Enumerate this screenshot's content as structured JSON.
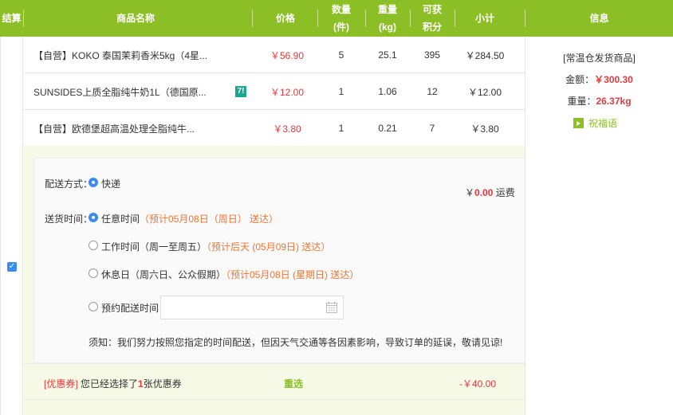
{
  "header": {
    "settle": "结算",
    "product_name": "商品名称",
    "price": "价格",
    "quantity_l1": "数量",
    "quantity_l2": "(件)",
    "weight_l1": "重量",
    "weight_l2": "(kg)",
    "points_l1": "可获",
    "points_l2": "积分",
    "subtotal": "小计",
    "info": "信息"
  },
  "items": [
    {
      "name": "【自营】KOKO 泰国茉莉香米5kg（4星...",
      "price": "￥56.90",
      "qty": "5",
      "weight": "25.1",
      "points": "395",
      "subtotal": "￥284.50"
    },
    {
      "name": "SUNSIDES上质全脂纯牛奶1L（德国原...",
      "price": "￥12.00",
      "qty": "1",
      "weight": "1.06",
      "points": "12",
      "subtotal": "￥12.00",
      "badge": "7!"
    },
    {
      "name": "【自营】欧德堡超高温处理全脂纯牛...",
      "price": "￥3.80",
      "qty": "1",
      "weight": "0.21",
      "points": "7",
      "subtotal": "￥3.80"
    }
  ],
  "info": {
    "warehouse": "[常温仓发货商品]",
    "amount_label": "金额：",
    "amount_value": "￥300.30",
    "weight_label": "重量：",
    "weight_value": "26.37kg",
    "blessing": "祝福语"
  },
  "shipping": {
    "method_label": "配送方式：",
    "method_option": "快递",
    "fee_prefix": "￥",
    "fee_value": "0.00",
    "fee_suffix": " 运费",
    "time_label": "送货时间：",
    "options": [
      {
        "label": "任意时间",
        "note": "（预计05月08日（周日） 送达）",
        "selected": true
      },
      {
        "label": "工作时间（周一至周五）",
        "note": "（预计后天 (05月09日) 送达）",
        "selected": false
      },
      {
        "label": "休息日（周六日、公众假期）",
        "note": "（预计05月08日 (星期日) 送达）",
        "selected": false
      },
      {
        "label": "预约配送时间",
        "note": "",
        "selected": false
      }
    ],
    "notice": "须知：我们努力按照您指定的时间配送，但因天气交通等各因素影响，导致订单的延误，敬请见谅!"
  },
  "coupon": {
    "tag": "[优惠券]",
    "text_before": " 您已经选择了",
    "count": "1",
    "text_after": "张优惠券",
    "reselect": "重选",
    "amount": "-￥40.00"
  },
  "colors": {
    "header_green": "#8cbf26",
    "price_red": "#e4393c",
    "note_orange": "#f0742f",
    "radio_blue": "#3a8bf2"
  }
}
